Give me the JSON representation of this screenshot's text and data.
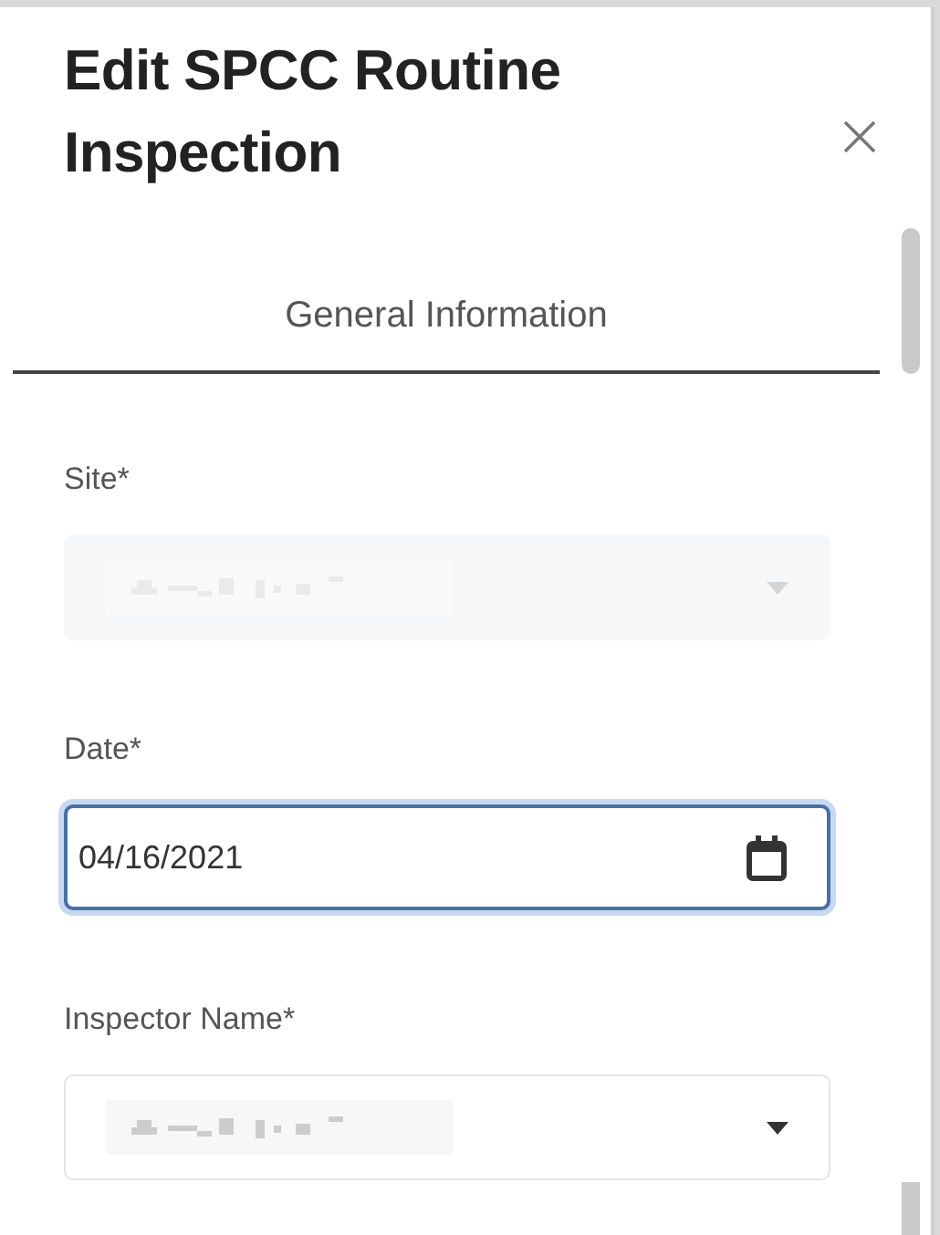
{
  "dialog": {
    "title": "Edit SPCC Routine Inspection"
  },
  "tabs": [
    {
      "label": "General Information",
      "selected": true
    }
  ],
  "fields": [
    {
      "kind": "select",
      "label": "Site*",
      "disabled": true,
      "focused": false
    },
    {
      "kind": "date",
      "label": "Date*",
      "value": "04/16/2021",
      "disabled": false,
      "focused": true
    },
    {
      "kind": "select",
      "label": "Inspector Name*",
      "disabled": false,
      "focused": false
    }
  ]
}
